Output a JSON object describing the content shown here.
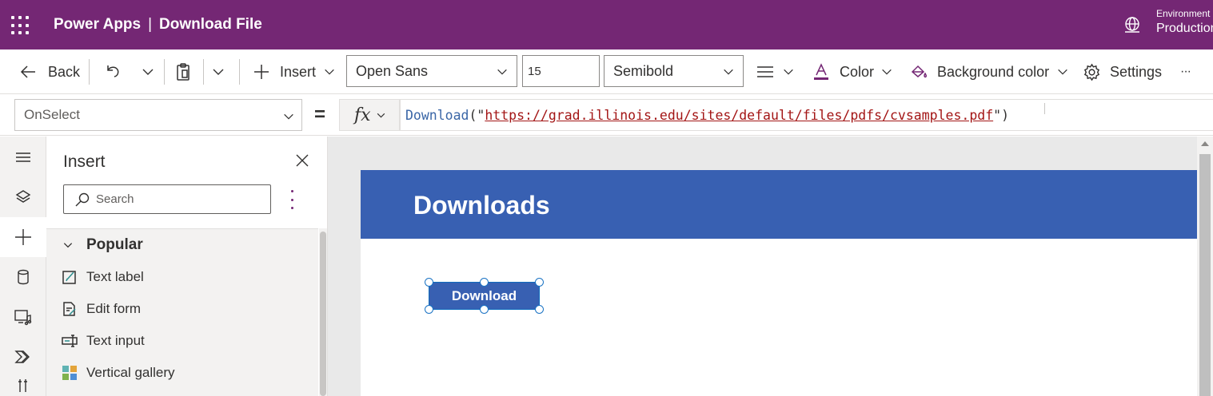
{
  "header": {
    "app_name": "Power Apps",
    "separator": "|",
    "document_title": "Download File",
    "environment_label": "Environment",
    "environment_value": "Production"
  },
  "toolbar": {
    "back_label": "Back",
    "insert_label": "Insert",
    "font_family": "Open Sans",
    "font_size": "15",
    "font_weight": "Semibold",
    "color_label": "Color",
    "background_color_label": "Background color",
    "settings_label": "Settings",
    "more_label": "···"
  },
  "formula_bar": {
    "property": "OnSelect",
    "equals": "=",
    "fx_label": "fx",
    "function_name": "Download",
    "open_paren": "(",
    "quote_open": "\"",
    "url_argument": "https://grad.illinois.edu/sites/default/files/pdfs/cvsamples.pdf",
    "quote_close": "\"",
    "close_paren": ")"
  },
  "insert_panel": {
    "title": "Insert",
    "search_placeholder": "Search",
    "group_label": "Popular",
    "items": [
      {
        "label": "Text label",
        "icon": "text-label-icon"
      },
      {
        "label": "Edit form",
        "icon": "edit-form-icon"
      },
      {
        "label": "Text input",
        "icon": "text-input-icon"
      },
      {
        "label": "Vertical gallery",
        "icon": "vertical-gallery-icon"
      }
    ]
  },
  "canvas": {
    "screen_title": "Downloads",
    "button_label": "Download"
  },
  "colors": {
    "brand": "#742774",
    "screen_header": "#3860b2",
    "button": "#3860b2",
    "formula_function": "#3a66a7",
    "formula_string": "#a31515"
  }
}
